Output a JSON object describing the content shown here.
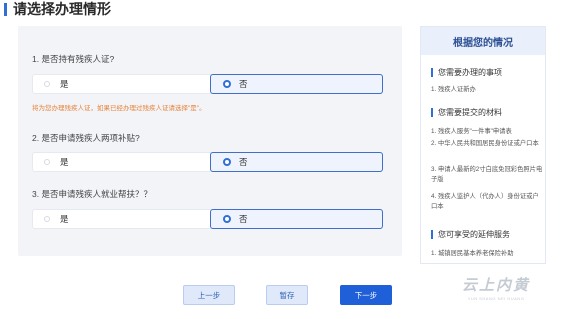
{
  "page": {
    "title": "请选择办理情形",
    "accent": "#2f6fd6"
  },
  "form": {
    "questions": [
      {
        "text": "1. 是否持有残疾人证?",
        "option_yes": "是",
        "option_no": "否",
        "selected": "否"
      },
      {
        "text": "2. 是否申请残疾人两项补贴?",
        "option_yes": "是",
        "option_no": "否",
        "selected": "否"
      },
      {
        "text": "3. 是否申请残疾人就业帮扶？？",
        "option_yes": "是",
        "option_no": "否",
        "selected": "否"
      }
    ],
    "hint": "将为您办理残疾人证，如果已经办理过残疾人证请选择\"是\"。",
    "hint_color": "#e8833a"
  },
  "side": {
    "header": "根据您的情况",
    "sections": [
      {
        "title": "您需要办理的事项",
        "items": [
          "1. 残疾人证新办"
        ]
      },
      {
        "title": "您需要提交的材料",
        "items": [
          "1. 残疾人服务\"一件事\"申请表",
          "2. 中华人民共和国居民身份证或户口本",
          "3. 申请人最新的2寸白底免冠彩色照片电子版",
          "4. 残疾人监护人（代办人）身份证或户口本"
        ]
      },
      {
        "title": "您可享受的延伸服务",
        "items": [
          "1. 城镇居民基本养老保险补助"
        ]
      }
    ]
  },
  "buttons": {
    "prev": "上一步",
    "save": "暂存",
    "next": "下一步"
  },
  "watermark": {
    "main": "云上内黄",
    "sub": "YUN SHANG NEI HUANG"
  }
}
